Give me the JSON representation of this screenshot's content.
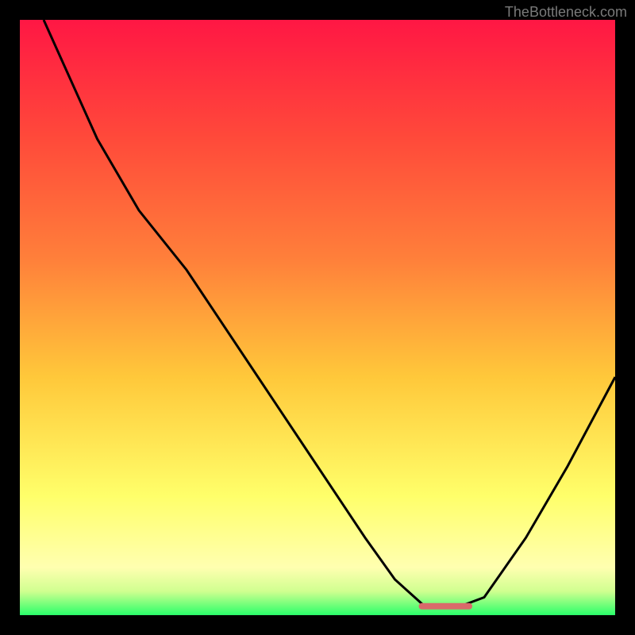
{
  "watermark": "TheBottleneck.com",
  "chart_data": {
    "type": "line",
    "title": "",
    "xlabel": "",
    "ylabel": "",
    "xlim": [
      0,
      100
    ],
    "ylim": [
      0,
      100
    ],
    "grid": false,
    "gradient_stops": [
      {
        "offset": 0,
        "color": "#ff1744"
      },
      {
        "offset": 20,
        "color": "#ff4a3a"
      },
      {
        "offset": 40,
        "color": "#ff7f3a"
      },
      {
        "offset": 60,
        "color": "#ffc83a"
      },
      {
        "offset": 80,
        "color": "#ffff6a"
      },
      {
        "offset": 92,
        "color": "#ffffb0"
      },
      {
        "offset": 96,
        "color": "#d0ff90"
      },
      {
        "offset": 100,
        "color": "#2aff6a"
      }
    ],
    "series": [
      {
        "name": "bottleneck-curve",
        "color": "#000000",
        "points": [
          {
            "x": 4,
            "y": 100
          },
          {
            "x": 13,
            "y": 80
          },
          {
            "x": 20,
            "y": 68
          },
          {
            "x": 28,
            "y": 58
          },
          {
            "x": 40,
            "y": 40
          },
          {
            "x": 50,
            "y": 25
          },
          {
            "x": 58,
            "y": 13
          },
          {
            "x": 63,
            "y": 6
          },
          {
            "x": 68,
            "y": 1.5
          },
          {
            "x": 74,
            "y": 1.5
          },
          {
            "x": 78,
            "y": 3
          },
          {
            "x": 85,
            "y": 13
          },
          {
            "x": 92,
            "y": 25
          },
          {
            "x": 100,
            "y": 40
          }
        ]
      }
    ],
    "flat_marker": {
      "x_start": 67,
      "x_end": 76,
      "y": 1.5,
      "color": "#d96a6a"
    }
  }
}
